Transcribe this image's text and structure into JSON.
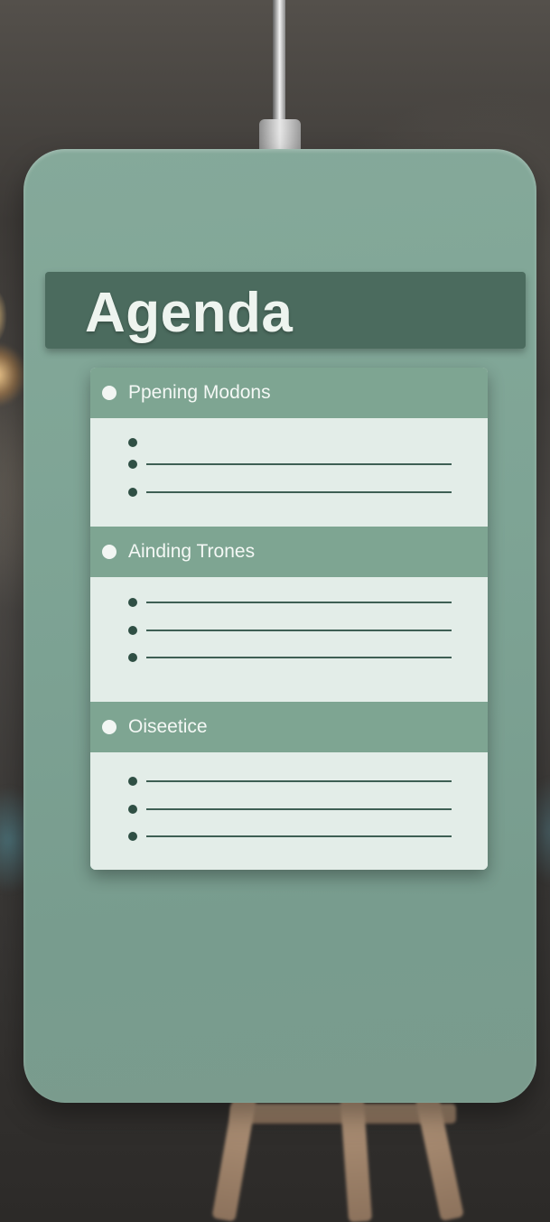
{
  "board": {
    "title": "Agenda"
  },
  "sections": [
    {
      "label": "Ppening Modons",
      "bullets": 3
    },
    {
      "label": "Ainding Trones",
      "bullets": 3
    },
    {
      "label": "Oiseetice",
      "bullets": 3
    }
  ],
  "colors": {
    "board": "#7ea495",
    "title_bar": "#4b6b5e",
    "section_header": "#7ea592",
    "section_body": "#e3ede8",
    "bullet": "#2f4f44"
  }
}
